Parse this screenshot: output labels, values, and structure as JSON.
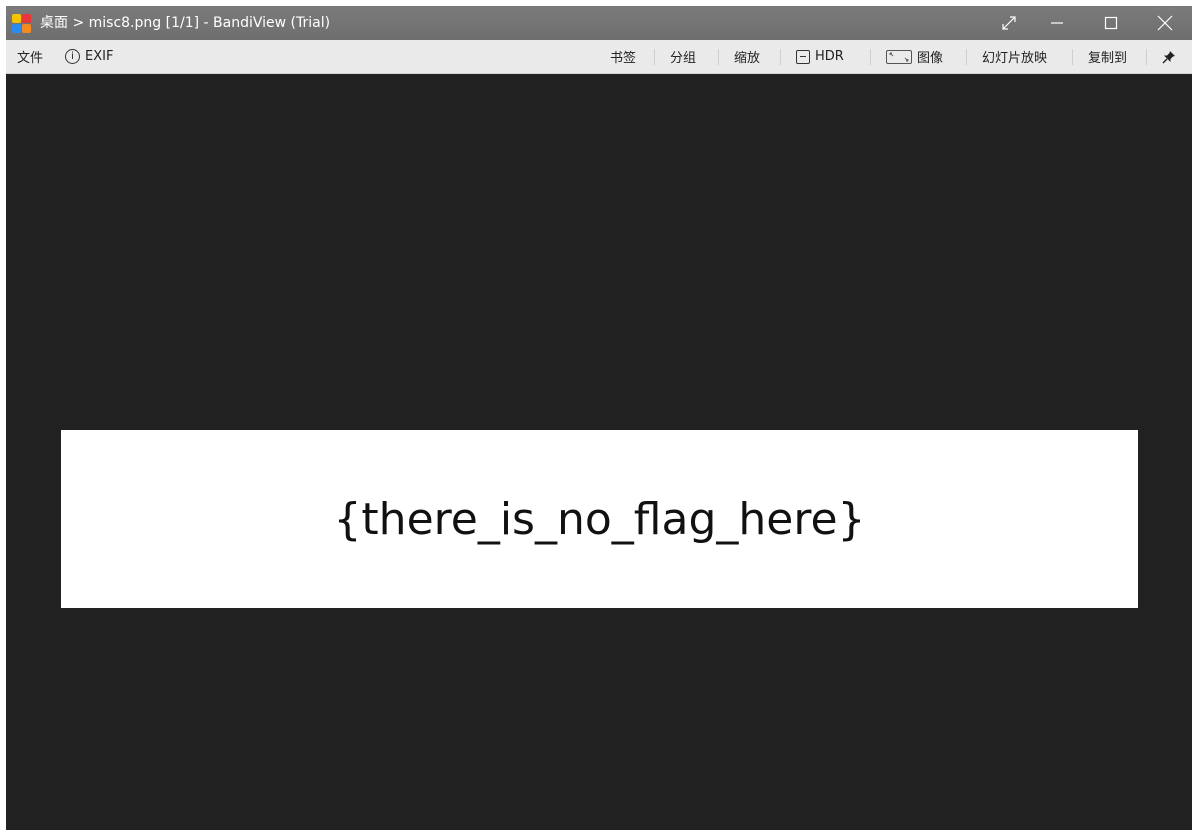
{
  "window": {
    "title": "桌面 > misc8.png [1/1] - BandiView (Trial)"
  },
  "toolbar": {
    "file": "文件",
    "exif": "EXIF",
    "bookmark": "书签",
    "group": "分组",
    "zoom": "缩放",
    "hdr": "HDR",
    "image": "图像",
    "slideshow": "幻灯片放映",
    "copy_to": "复制到"
  },
  "viewer": {
    "image_text": "{there_is_no_flag_here}"
  },
  "icons": {
    "app": "bandiview-logo-icon",
    "fullscreen": "fullscreen-arrow-icon",
    "minimize": "minimize-icon",
    "maximize": "maximize-icon",
    "close": "close-icon",
    "pin": "pin-icon",
    "info": "info-icon",
    "hdr": "hdr-icon",
    "image": "image-fit-icon"
  }
}
